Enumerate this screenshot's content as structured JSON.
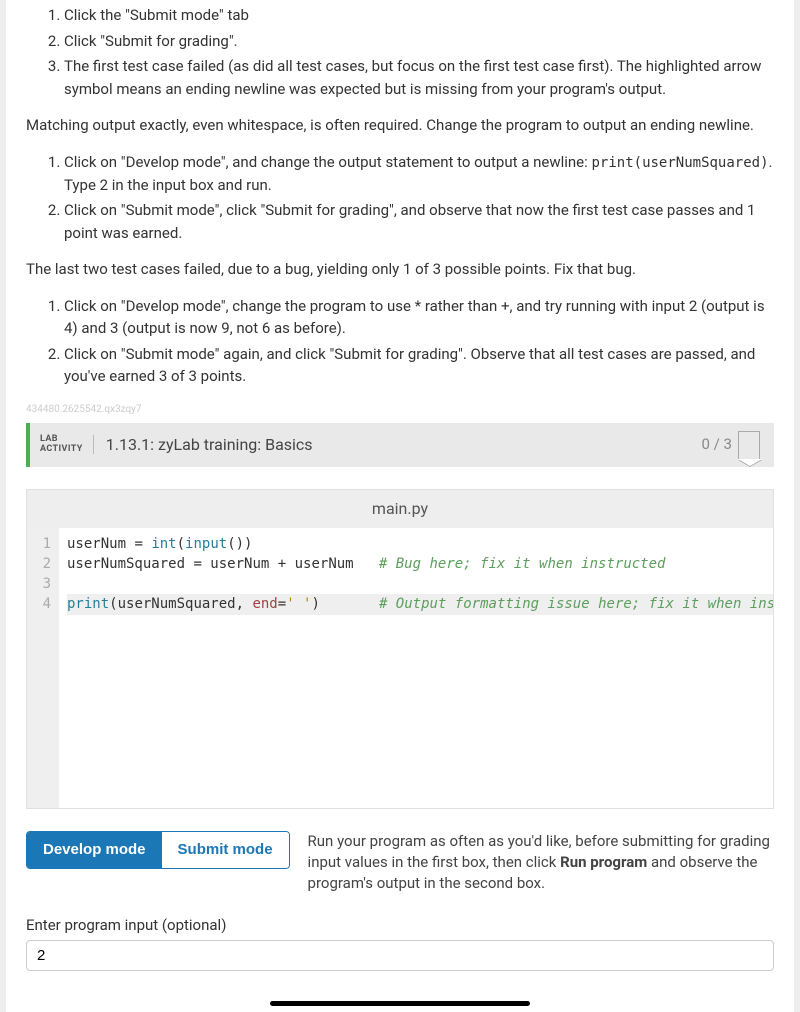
{
  "instructions": {
    "list1": [
      "Click the \"Submit mode\" tab",
      "Click \"Submit for grading\".",
      "The first test case failed (as did all test cases, but focus on the first test case first). The highlighted arrow symbol means an ending newline was expected but is missing from your program's output."
    ],
    "para1": "Matching output exactly, even whitespace, is often required. Change the program to output an ending newline.",
    "list2_item1_pre": "Click on \"Develop mode\", and change the output statement to output a newline: ",
    "list2_item1_code": "print(userNumSquared)",
    "list2_item1_post": ". Type 2 in the input box and run.",
    "list2_item2": "Click on \"Submit mode\", click \"Submit for grading\", and observe that now the first test case passes and 1 point was earned.",
    "para2": "The last two test cases failed, due to a bug, yielding only 1 of 3 possible points. Fix that bug.",
    "list3": [
      "Click on \"Develop mode\", change the program to use * rather than +, and try running with input 2 (output is 4) and 3 (output is now 9, not 6 as before).",
      "Click on \"Submit mode\" again, and click \"Submit for grading\". Observe that all test cases are passed, and you've earned 3 of 3 points."
    ]
  },
  "watermark": "434480.2625542.qx3zqy7",
  "lab": {
    "label_line1": "LAB",
    "label_line2": "ACTIVITY",
    "number_title": "1.13.1: zyLab training: Basics",
    "score": "0 / 3"
  },
  "editor": {
    "filename": "main.py",
    "gutter": [
      "1",
      "2",
      "3",
      "4"
    ],
    "code": {
      "l1_a": "userNum ",
      "l1_eq": "=",
      "l1_b": " ",
      "l1_int": "int",
      "l1_po": "(",
      "l1_input": "input",
      "l1_pp": "())",
      "l2_a": "userNumSquared ",
      "l2_eq": "=",
      "l2_b": " userNum ",
      "l2_plus": "+",
      "l2_c": " userNum   ",
      "l2_cmt": "# Bug here; fix it when instructed",
      "l4_print": "print",
      "l4_po": "(",
      "l4_a": "userNumSquared, ",
      "l4_end": "end",
      "l4_eq": "=",
      "l4_str": "' '",
      "l4_pc": ")",
      "l4_sp": "       ",
      "l4_cmt": "# Output formatting issue here; fix it when instructed"
    }
  },
  "modes": {
    "develop": "Develop mode",
    "submit": "Submit mode",
    "desc_a": "Run your program as often as you'd like, before submitting for grading input values in the first box, then click ",
    "desc_bold": "Run program",
    "desc_b": " and observe the program's output in the second box."
  },
  "input": {
    "label": "Enter program input (optional)",
    "value": "2"
  }
}
